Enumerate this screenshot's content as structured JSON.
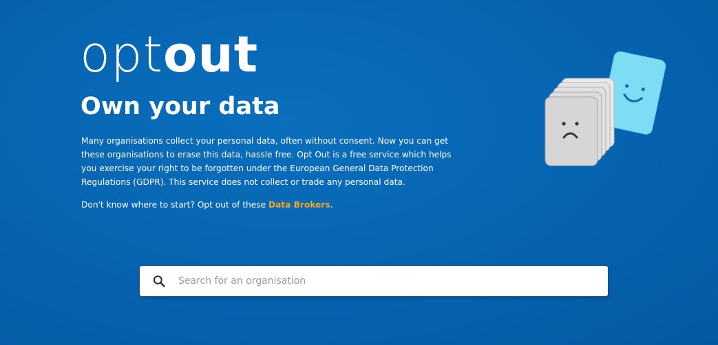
{
  "logo": {
    "light": "opt",
    "bold": "out"
  },
  "hero": {
    "title": "Own your data",
    "intro": "Many organisations collect your personal data, often without consent. Now you can get these organisations to erase this data, hassle free. Opt Out is a free service which helps you exercise your right to be forgotten under the European General Data Protection Regulations (GDPR). This service does not collect or trade any personal data.",
    "cta_prefix": "Don't know where to start? Opt out of these ",
    "cta_link": "Data Brokers",
    "cta_suffix": "."
  },
  "search": {
    "placeholder": "Search for an organisation",
    "value": "",
    "icon": "search-icon"
  },
  "illustration": {
    "icons": [
      "sad-face-card-stack-icon",
      "happy-face-card-icon"
    ]
  },
  "colors": {
    "background": "#0765b2",
    "link": "#f5a623",
    "happy_card": "#7fdcf5",
    "sad_card": "#d8d8d8"
  }
}
